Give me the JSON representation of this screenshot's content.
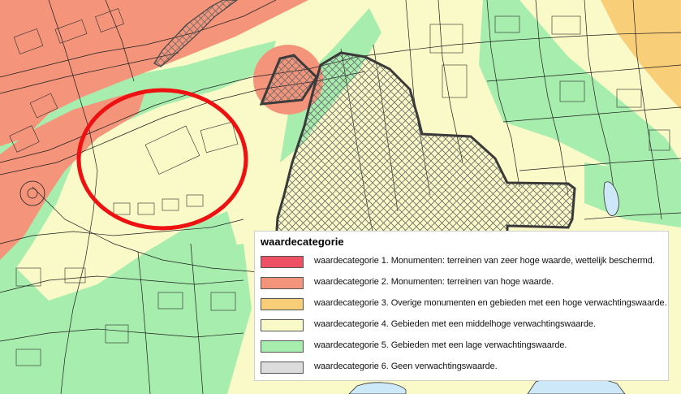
{
  "map": {
    "zone_colors": {
      "cat1": "#ee5064",
      "cat2": "#f4957b",
      "cat3": "#f9ce78",
      "cat4": "#fafac8",
      "cat5": "#a6edae",
      "cat6": "#dcdcdc"
    },
    "highlight_color": "#ee1111",
    "monument_outline_color": "#555555",
    "water_color": "#cde8f8"
  },
  "legend": {
    "title": "waardecategorie",
    "items": [
      {
        "label": "waardecategorie 1. Monumenten: terreinen van zeer hoge waarde, wettelijk beschermd.",
        "color": "#ee5064"
      },
      {
        "label": "waardecategorie 2. Monumenten: terreinen van hoge waarde.",
        "color": "#f4957b"
      },
      {
        "label": "waardecategorie 3. Overige monumenten en gebieden met een hoge verwachtingswaarde.",
        "color": "#f9ce78"
      },
      {
        "label": "waardecategorie 4. Gebieden met een middelhoge verwachtingswaarde.",
        "color": "#fafac8"
      },
      {
        "label": "waardecategorie 5. Gebieden met een lage verwachtingswaarde.",
        "color": "#a6edae"
      },
      {
        "label": "waardecategorie 6. Geen verwachtingswaarde.",
        "color": "#dcdcdc"
      }
    ]
  }
}
